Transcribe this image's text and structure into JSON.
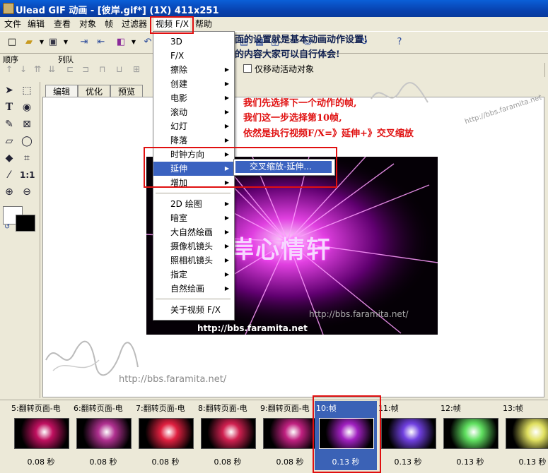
{
  "window": {
    "title": "Ulead GIF 动画 - [彼岸.gif*] (1X) 411x251"
  },
  "menubar": [
    {
      "label": "文件"
    },
    {
      "label": "编辑"
    },
    {
      "label": "查看"
    },
    {
      "label": "对象"
    },
    {
      "label": "帧"
    },
    {
      "label": "过滤器"
    },
    {
      "label": "视频 F/X"
    },
    {
      "label": "帮助"
    }
  ],
  "toolbar2": {
    "group1_label": "顺序",
    "group2_label": "列队",
    "checkbox_label": "仅移动活动对象",
    "checkbox_checked": false,
    "zoom_label": "1:1"
  },
  "tabs": [
    {
      "label": "编辑"
    },
    {
      "label": "优化"
    },
    {
      "label": "预览"
    }
  ],
  "dropdown": {
    "items": [
      {
        "label": "3D",
        "submenu": false
      },
      {
        "label": "F/X",
        "submenu": false
      },
      {
        "label": "擦除",
        "submenu": true
      },
      {
        "label": "创建",
        "submenu": true
      },
      {
        "label": "电影",
        "submenu": true
      },
      {
        "label": "滚动",
        "submenu": true
      },
      {
        "label": "幻灯",
        "submenu": true
      },
      {
        "label": "降落",
        "submenu": true
      },
      {
        "label": "时钟方向",
        "submenu": true
      },
      {
        "label": "延伸",
        "submenu": true
      },
      {
        "label": "增加",
        "submenu": true
      },
      {
        "label": "2D 绘图",
        "submenu": true
      },
      {
        "label": "暗室",
        "submenu": true
      },
      {
        "label": "大自然绘画",
        "submenu": true
      },
      {
        "label": "摄像机镜头",
        "submenu": true
      },
      {
        "label": "照相机镜头",
        "submenu": true
      },
      {
        "label": "指定",
        "submenu": true
      },
      {
        "label": "自然绘画",
        "submenu": true
      },
      {
        "label": "关于视频 F/X",
        "submenu": false
      }
    ],
    "submenu_item": "交叉缩放-延伸..."
  },
  "annotations": {
    "top_line1": "这里面的设置就是基本动画动作设置!",
    "top_line2": "里面的内容大家可以自行体会!",
    "red_line1": "我们先选择下一个动作的帧,",
    "red_line2": "我们这一步选择第10帧,",
    "red_line3": "依然是执行视频F/X=》延伸+》交叉缩放"
  },
  "preview": {
    "title_text": "岸心情轩",
    "url_white": "http://bbs.faramita.net",
    "url_gray": "http://bbs.faramita.net/",
    "url_canvas": "http://bbs.faramita.net/",
    "url_topright": "http://bbs.faramita.net"
  },
  "frames": [
    {
      "label": "5:翻转页面-电",
      "time": "0.08 秒",
      "selected": false
    },
    {
      "label": "6:翻转页面-电",
      "time": "0.08 秒",
      "selected": false
    },
    {
      "label": "7:翻转页面-电",
      "time": "0.08 秒",
      "selected": false
    },
    {
      "label": "8:翻转页面-电",
      "time": "0.08 秒",
      "selected": false
    },
    {
      "label": "9:翻转页面-电",
      "time": "0.08 秒",
      "selected": false
    },
    {
      "label": "10:帧",
      "time": "0.13 秒",
      "selected": true
    },
    {
      "label": "11:帧",
      "time": "0.13 秒",
      "selected": false
    },
    {
      "label": "12:帧",
      "time": "0.13 秒",
      "selected": false
    },
    {
      "label": "13:帧",
      "time": "0.13 秒",
      "selected": false
    }
  ],
  "colors": {
    "annotation_red": "#e01010",
    "selected_frame": "#3b62b6",
    "title_bar": "#0842b0"
  }
}
